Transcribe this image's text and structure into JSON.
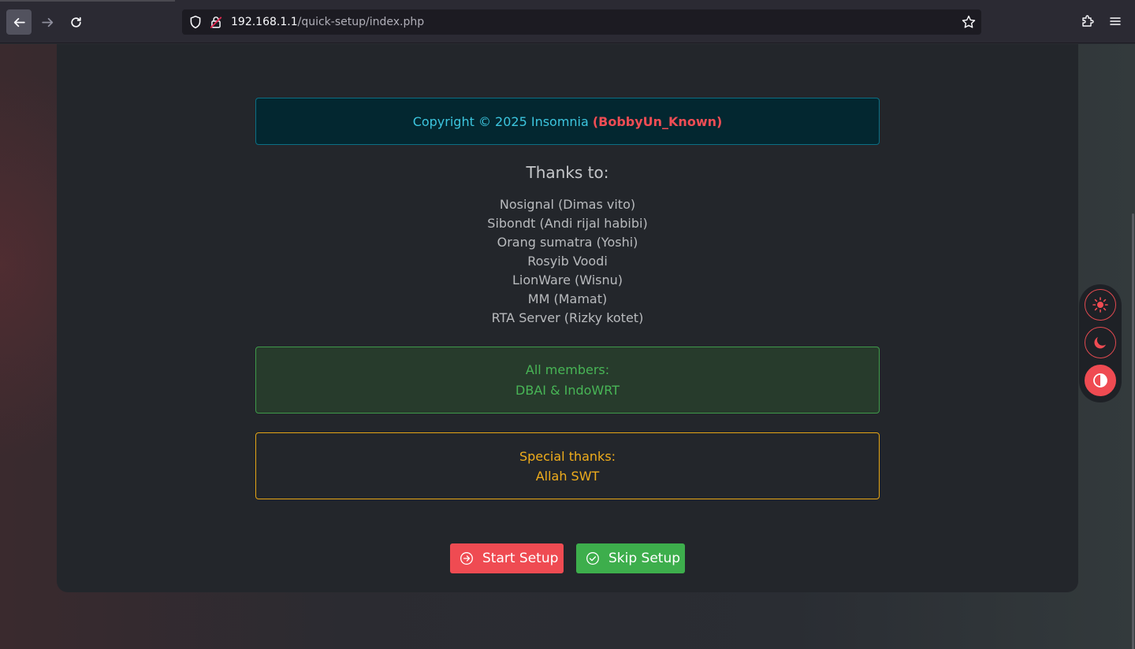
{
  "browser": {
    "url_host": "192.168.1.1",
    "url_path": "/quick-setup/index.php"
  },
  "copyright": {
    "text": "Copyright © 2025 Insomnia",
    "author": "(BobbyUn_Known)"
  },
  "thanks": {
    "title": "Thanks to:",
    "names": [
      "Nosignal (Dimas vito)",
      "Sibondt (Andi rijal habibi)",
      "Orang sumatra (Yoshi)",
      "Rosyib Voodi",
      "LionWare (Wisnu)",
      "MM (Mamat)",
      "RTA Server (Rizky kotet)"
    ]
  },
  "members": {
    "label": "All members:",
    "value": "DBAI & IndoWRT"
  },
  "special": {
    "label": "Special thanks:",
    "value": "Allah SWT"
  },
  "actions": {
    "start_label": "Start Setup",
    "skip_label": "Skip Setup"
  },
  "theme_switcher": {
    "options": [
      "light-icon",
      "dark-icon",
      "auto-contrast-icon"
    ],
    "active": "auto-contrast-icon"
  },
  "colors": {
    "primary_red": "#ef4b52",
    "success_green": "#3dae4c",
    "warning_amber": "#f0ad1c",
    "info_cyan": "#3cc5de",
    "logo_glow": "#38b8f0"
  }
}
